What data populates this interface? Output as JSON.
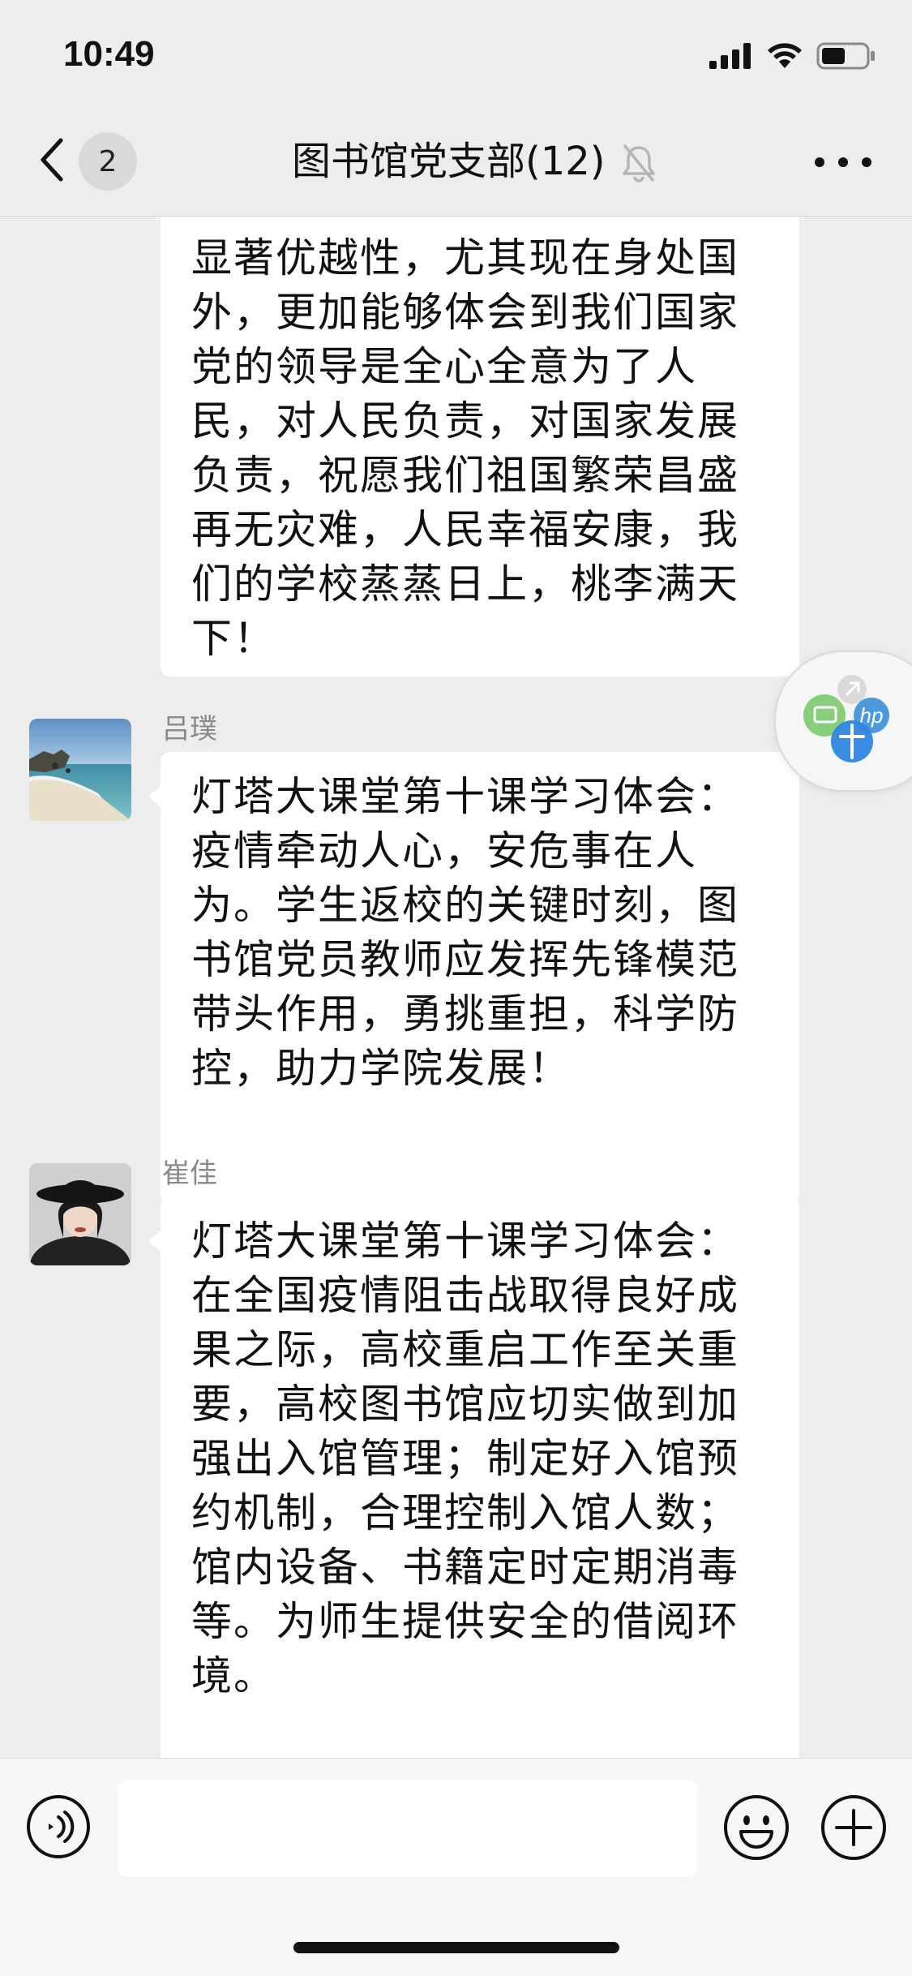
{
  "status_bar": {
    "time": "10:49",
    "icons": [
      "signal-icon",
      "wifi-icon",
      "battery-icon"
    ]
  },
  "nav": {
    "back_icon": "chevron-left-icon",
    "unread_count": "2",
    "title": "图书馆党支部(12)",
    "mute_icon": "bell-muted-icon",
    "more_icon": "ellipsis-icon"
  },
  "messages": [
    {
      "sender": "",
      "lines": [
        "显著优越性，尤其现在身处国",
        "外，更加能够体会到我们国家",
        "党的领导是全心全意为了人",
        "民，对人民负责，对国家发展",
        "负责，祝愿我们祖国繁荣昌盛",
        "再无灾难，人民幸福安康，我",
        "们的学校蒸蒸日上，桃李满天",
        "下！"
      ]
    },
    {
      "sender": "吕璞",
      "avatar": "beach-avatar",
      "lines": [
        "灯塔大课堂第十课学习体会：",
        "疫情牵动人心，安危事在人",
        "为。学生返校的关键时刻，图",
        "书馆党员教师应发挥先锋模范",
        "带头作用，勇挑重担，科学防",
        "控，助力学院发展！"
      ]
    },
    {
      "sender": "崔佳",
      "avatar": "portrait-avatar",
      "lines": [
        "灯塔大课堂第十课学习体会：",
        "在全国疫情阻击战取得良好成",
        "果之际，高校重启工作至关重",
        "要，高校图书馆应切实做到加",
        "强出入馆管理；制定好入馆预",
        "约机制，合理控制入馆人数；",
        "馆内设备、书籍定时定期消毒",
        "等。为师生提供安全的借阅环",
        "境。"
      ]
    }
  ],
  "input_bar": {
    "voice_icon": "voice-icon",
    "input_value": "",
    "emoji_icon": "emoji-icon",
    "plus_icon": "plus-icon"
  },
  "colors": {
    "background": "#EDEDED",
    "bubble": "#FFFFFF",
    "sender_name": "#8A8A8A",
    "input_bar": "#F7F7F7"
  }
}
